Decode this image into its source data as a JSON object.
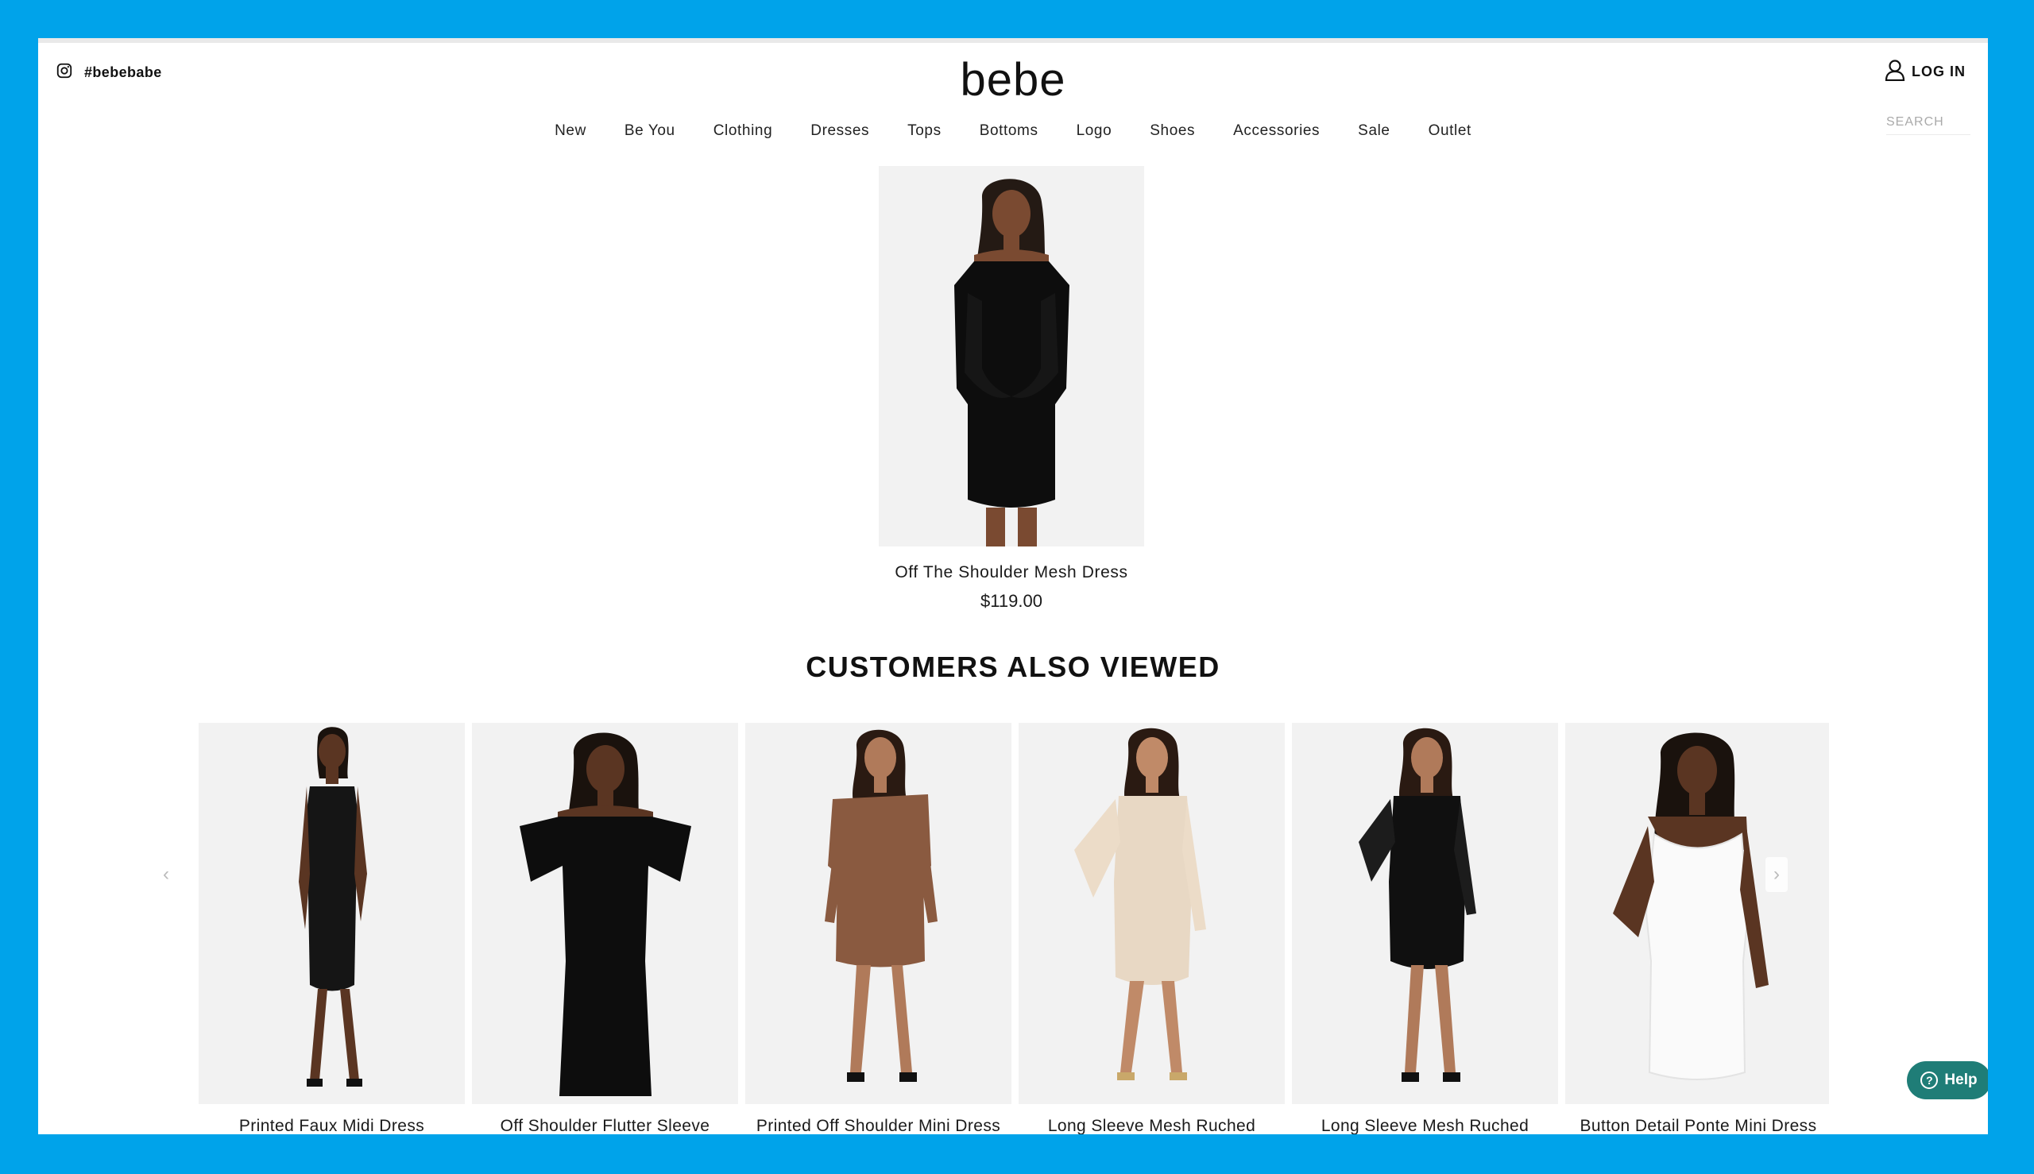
{
  "header": {
    "instagram_handle": "#bebebabe",
    "brand": "bebe",
    "login_label": "LOG IN",
    "search_placeholder": "SEARCH"
  },
  "nav": {
    "items": [
      "New",
      "Be You",
      "Clothing",
      "Dresses",
      "Tops",
      "Bottoms",
      "Logo",
      "Shoes",
      "Accessories",
      "Sale",
      "Outlet"
    ]
  },
  "featured": {
    "name": "Off The Shoulder Mesh Dress",
    "price": "$119.00"
  },
  "customers_also_viewed": {
    "title": "CUSTOMERS ALSO VIEWED",
    "products": [
      {
        "name": "Printed Faux Midi Dress"
      },
      {
        "name": "Off Shoulder Flutter Sleeve"
      },
      {
        "name": "Printed Off Shoulder Mini Dress"
      },
      {
        "name": "Long Sleeve Mesh Ruched"
      },
      {
        "name": "Long Sleeve Mesh Ruched"
      },
      {
        "name": "Button Detail Ponte Mini Dress"
      }
    ]
  },
  "help": {
    "label": "Help"
  },
  "icons": {
    "instagram": "instagram-icon",
    "user": "user-icon",
    "prev": "chevron-left-icon",
    "next": "chevron-right-icon",
    "help": "question-circle-icon"
  },
  "colors": {
    "frame": "#00a3ea",
    "page_bg": "#ffffff",
    "product_bg": "#f2f2f2",
    "help_bg": "#1f7d77"
  }
}
